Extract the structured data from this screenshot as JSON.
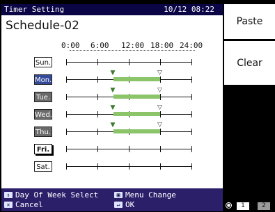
{
  "header": {
    "title": "Timer Setting",
    "datetime": "10/12 08:22"
  },
  "schedule_name": "Schedule-02",
  "axis_labels": [
    "0:00",
    "6:00",
    "12:00",
    "18:00",
    "24:00"
  ],
  "days": [
    {
      "label": "Sun.",
      "style": "normal",
      "on": null,
      "off": null
    },
    {
      "label": "Mon.",
      "style": "selected",
      "on": "9:00",
      "off": "18:00"
    },
    {
      "label": "Tue.",
      "style": "grey",
      "on": "9:00",
      "off": "18:00"
    },
    {
      "label": "Wed.",
      "style": "grey",
      "on": "9:00",
      "off": "18:00"
    },
    {
      "label": "Thu.",
      "style": "grey",
      "on": "9:00",
      "off": "18:00"
    },
    {
      "label": "Fri.",
      "style": "focus",
      "on": null,
      "off": null
    },
    {
      "label": "Sat.",
      "style": "normal",
      "on": null,
      "off": null
    }
  ],
  "status": {
    "item1": "Day Of Week Select",
    "item2": "Menu Change",
    "item3": "Cancel",
    "item4": "OK"
  },
  "side": {
    "paste": "Paste",
    "clear": "Clear"
  },
  "pager": {
    "page1": "1",
    "page2": "2"
  },
  "colors": {
    "bar": "#8cc46a",
    "selected_day": "#344a9a",
    "background": "#2b1f6a"
  }
}
